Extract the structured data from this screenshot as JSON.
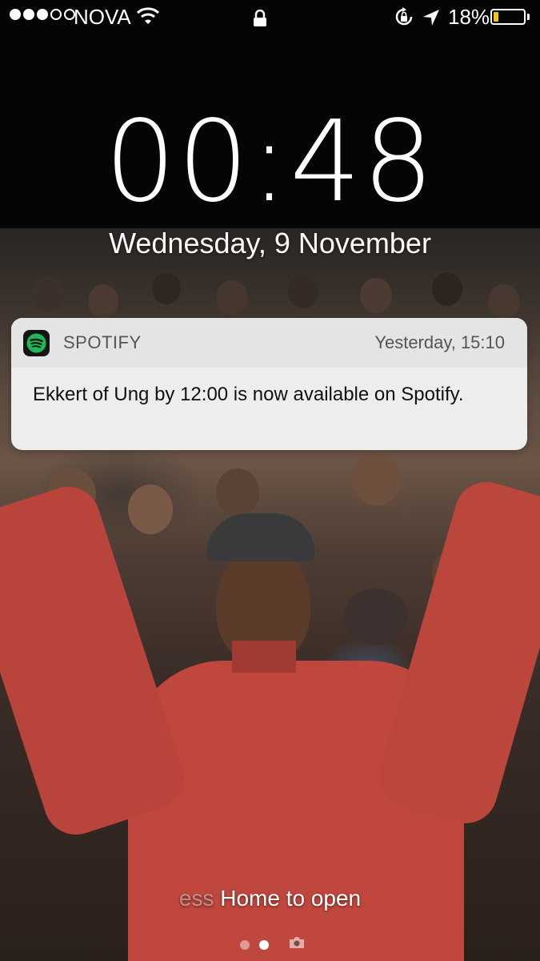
{
  "status_bar": {
    "carrier": "NOVA",
    "signal_bars_filled": 3,
    "signal_bars_total": 5,
    "battery_percent": "18%",
    "battery_level": 0.18,
    "battery_color": "#f7c600",
    "icons": [
      "signal-dots-icon",
      "wifi-icon",
      "padlock-icon",
      "rotation-lock-icon",
      "location-arrow-icon",
      "battery-icon"
    ]
  },
  "lock_screen": {
    "time": "00:48",
    "date": "Wednesday, 9 November"
  },
  "notification": {
    "app_name": "SPOTIFY",
    "timestamp": "Yesterday, 15:10",
    "message": "Ekkert of Ung by 12:00 is now available on Spotify.",
    "app_icon": "spotify-icon",
    "brand_color": "#1db954"
  },
  "footer": {
    "hint_faded": "ess",
    "hint_main": "Home to open",
    "page_count": 2,
    "current_page": 2,
    "camera_icon": "camera-icon"
  }
}
